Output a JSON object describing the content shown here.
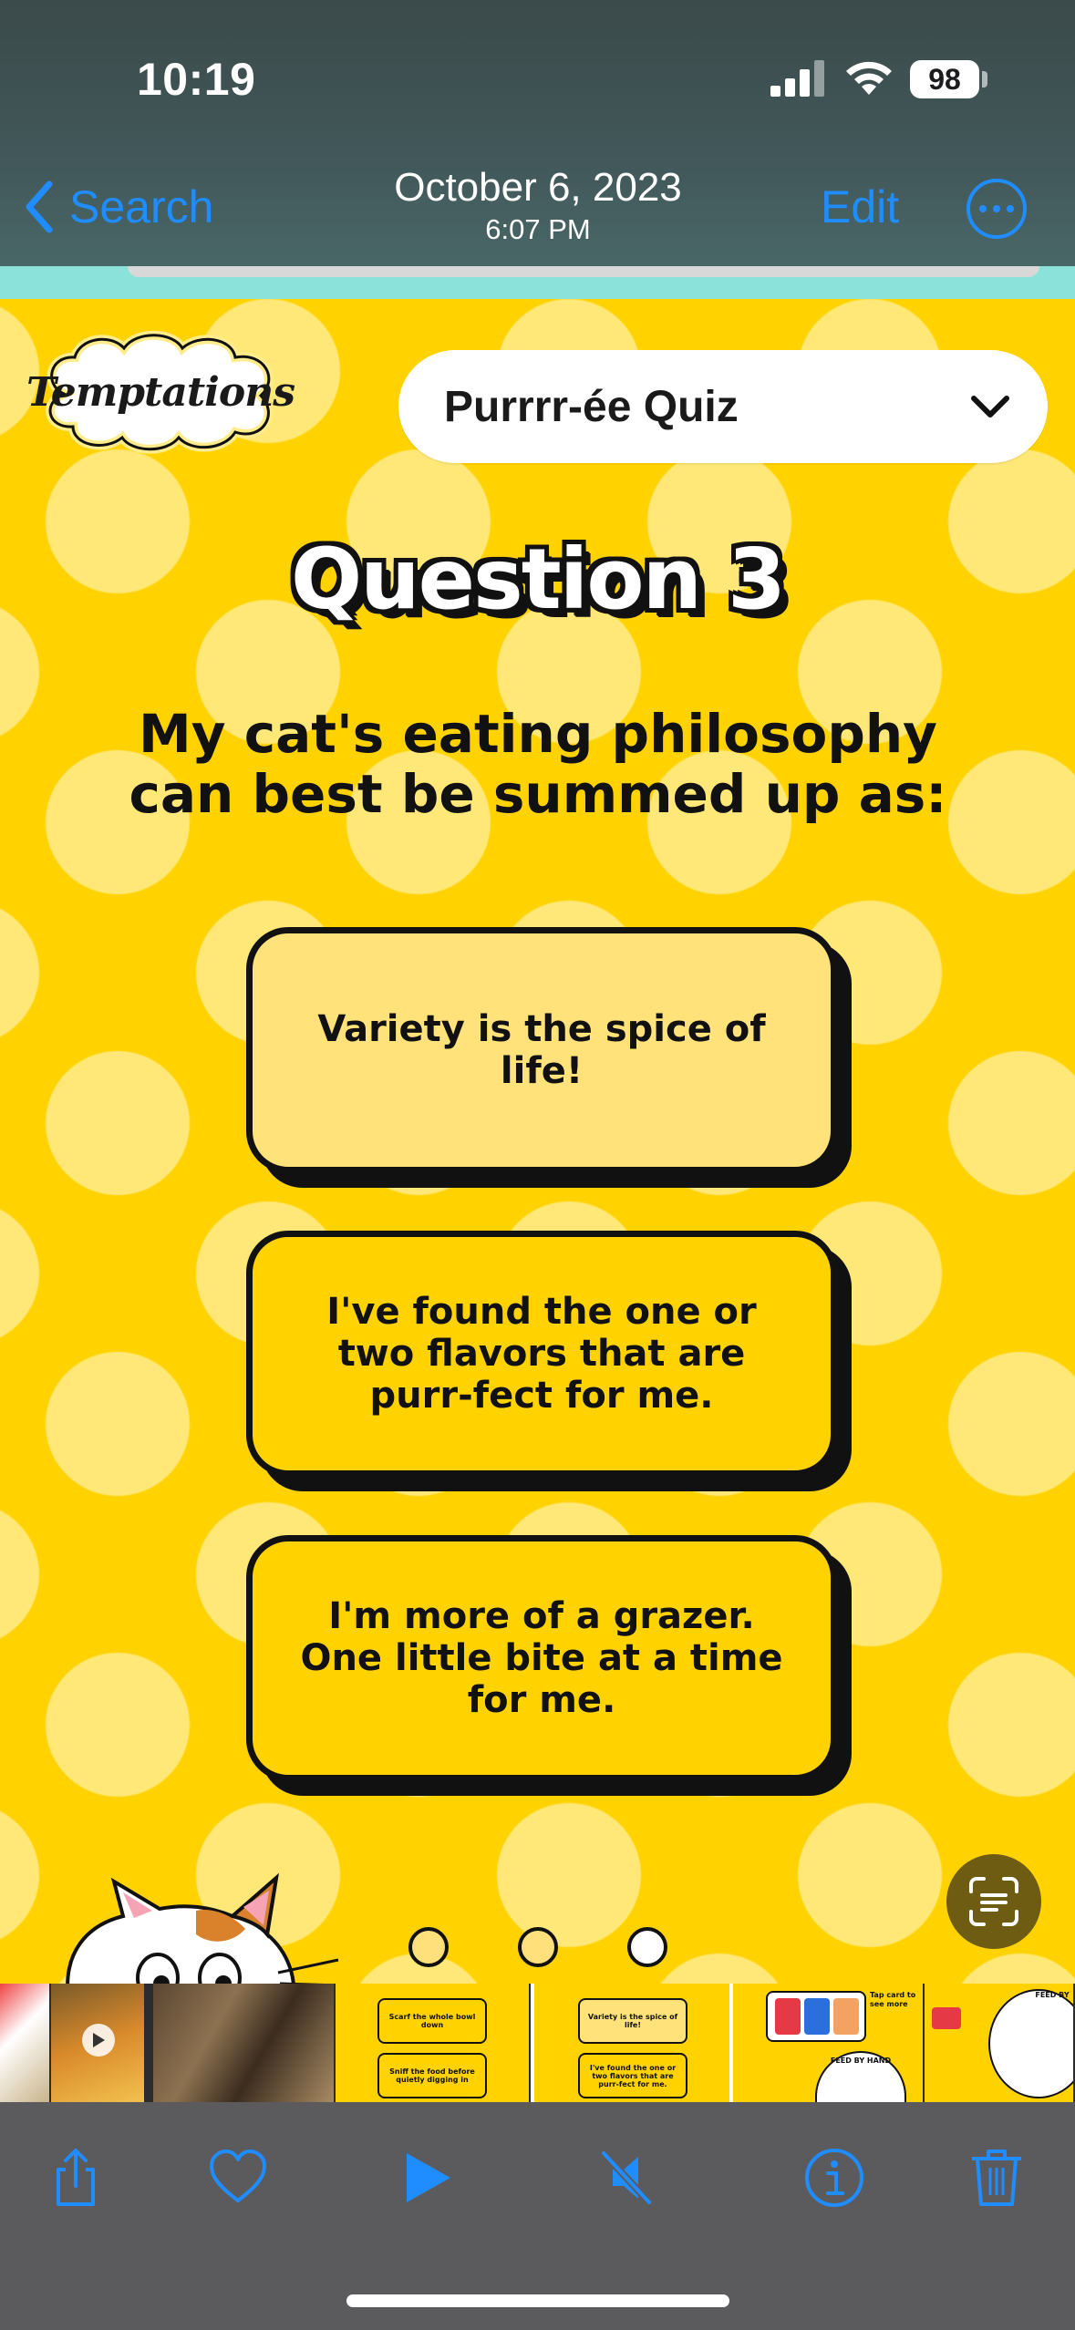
{
  "status_bar": {
    "time": "10:19",
    "battery": "98"
  },
  "nav": {
    "back_label": "Search",
    "date": "October 6, 2023",
    "time": "6:07 PM",
    "edit_label": "Edit"
  },
  "photo": {
    "brand": "Temptations",
    "quiz_selector": "Purrrr-ée Quiz",
    "question_title": "Question 3",
    "question_text": "My cat's eating philosophy can best be summed up as:",
    "answers": [
      "Variety is the spice of life!",
      "I've found the one or two flavors that are purr-fect for me.",
      "I'm more of a grazer. One little bite at a time for me."
    ],
    "pagination": {
      "count": 3,
      "active_index": 2
    }
  },
  "thumbnails": {
    "t3_top": "Scarf the whole bowl down",
    "t3_bottom": "Sniff the food before quietly digging in",
    "t4_top": "Variety is the spice of life!",
    "t4_bottom": "I've found the one or two flavors that are purr-fect for me.",
    "t5_text": "Tap card to see more",
    "t5_sub": "FEED BY HAND",
    "t6_text": "FEED BY"
  },
  "colors": {
    "accent": "#1f8dff",
    "quiz_yellow": "#ffd200",
    "toolbar_bg": "#5b5b5e"
  },
  "toolbar": {
    "icons": [
      "share-icon",
      "heart-icon",
      "play-icon",
      "mute-icon",
      "info-icon",
      "trash-icon"
    ]
  }
}
